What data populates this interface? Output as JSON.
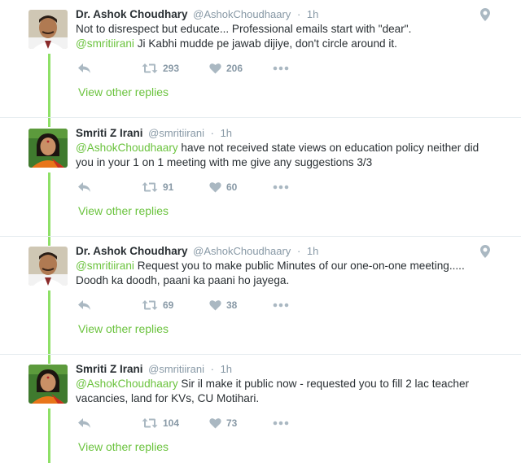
{
  "colors": {
    "accent": "#6bc33e",
    "thread": "#8ee067",
    "muted": "#8899a6"
  },
  "tweets": [
    {
      "name": "Dr. Ashok Choudhary",
      "handle": "@AshokChoudhaary",
      "time": "1h",
      "text_plain": "Not to disrespect but educate... Professional emails start with \"dear\".",
      "mention": "@smritiirani",
      "text_after": " Ji Kabhi mudde pe jawab dijiye, don't circle around it.",
      "retweets": "293",
      "likes": "206",
      "view_replies": "View other replies",
      "icons": [
        "reply-icon",
        "retweet-icon",
        "heart-icon",
        "more-icon",
        "location-pin-icon"
      ]
    },
    {
      "name": "Smriti Z Irani",
      "handle": "@smritiirani",
      "time": "1h",
      "mention": "@AshokChoudhaary",
      "text_after": " have not received state views on education policy neither did you in your 1 on 1 meeting with me give any suggestions 3/3",
      "retweets": "91",
      "likes": "60",
      "view_replies": "View other replies",
      "icons": [
        "reply-icon",
        "retweet-icon",
        "heart-icon",
        "more-icon"
      ]
    },
    {
      "name": "Dr. Ashok Choudhary",
      "handle": "@AshokChoudhaary",
      "time": "1h",
      "mention": "@smritiirani",
      "text_after": " Request you to make public Minutes of our one-on-one meeting..... Doodh ka doodh, paani ka paani ho jayega.",
      "retweets": "69",
      "likes": "38",
      "view_replies": "View other replies",
      "icons": [
        "reply-icon",
        "retweet-icon",
        "heart-icon",
        "more-icon",
        "location-pin-icon"
      ]
    },
    {
      "name": "Smriti Z Irani",
      "handle": "@smritiirani",
      "time": "1h",
      "mention": "@AshokChoudhaary",
      "text_after": " Sir il make it public now - requested you to fill 2 lac teacher vacancies, land for KVs, CU Motihari.",
      "retweets": "104",
      "likes": "73",
      "view_replies": "View other replies",
      "icons": [
        "reply-icon",
        "retweet-icon",
        "heart-icon",
        "more-icon"
      ]
    }
  ]
}
